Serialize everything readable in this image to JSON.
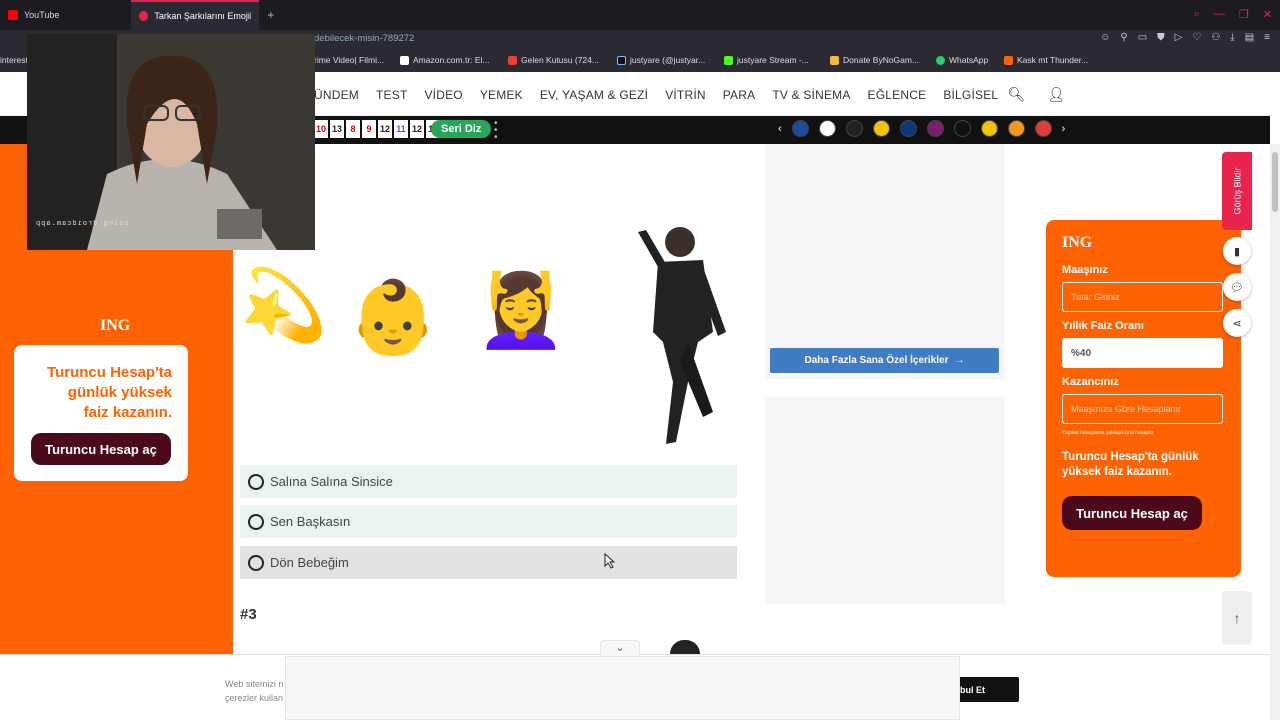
{
  "browser": {
    "tabs": [
      {
        "label": "YouTube",
        "active": false
      },
      {
        "label": "Tarkan Şarkılarını Emojilerl",
        "active": true
      }
    ],
    "new_tab_icon": "plus-icon",
    "url_fragment": "debilecek-misin-789272",
    "bookmarks": [
      {
        "label": "interest",
        "color": "#e60023"
      },
      {
        "label": "rime Video| Filmi...",
        "color": "#1a98ff"
      },
      {
        "label": "Amazon.com.tr: El...",
        "color": "#ff9900"
      },
      {
        "label": "Gelen Kutusu (724...",
        "color": "#ea4335"
      },
      {
        "label": "justyare (@justyar...",
        "color": "#111111"
      },
      {
        "label": "justyare Stream -...",
        "color": "#53fc18"
      },
      {
        "label": "Donate ByNoGam...",
        "color": "#f6b73c"
      },
      {
        "label": "WhatsApp",
        "color": "#25d366"
      },
      {
        "label": "Kask mt Thunder...",
        "color": "#ff6000"
      }
    ]
  },
  "site": {
    "menu": [
      "GÜNDEM",
      "TEST",
      "VİDEO",
      "YEMEK",
      "EV, YAŞAM & GEZİ",
      "VİTRİN",
      "PARA",
      "TV & SİNEMA",
      "EĞLENCE",
      "BİLGİSEL"
    ],
    "menu_first_visible": "ÜNDEM",
    "lotto_numbers": [
      "10",
      "13",
      "8",
      "9",
      "12",
      "11",
      "12",
      "11"
    ],
    "seri_diz_label": "Seri Diz",
    "accent": "#ff6200"
  },
  "left_ad": {
    "brand": "ING",
    "tagline": "Turuncu Hesap'ta\ngünlük yüksek\nfaiz kazanın.",
    "button": "Turuncu Hesap aç"
  },
  "quiz": {
    "emoji_clue": [
      "💫",
      "👶",
      "💆‍♀️"
    ],
    "options": [
      {
        "label": "Salına Salına Sinsice",
        "selected": false
      },
      {
        "label": "Sen Başkasın",
        "selected": false
      },
      {
        "label": "Dön Bebeğim",
        "selected": false
      }
    ],
    "next_question_label": "#3"
  },
  "right_panel": {
    "more_button": "Daha Fazla Sana Özel İçerikler"
  },
  "right_ad": {
    "brand": "ING",
    "salary_label": "Maaşınız",
    "salary_placeholder": "Tutar Giriniz",
    "rate_label": "Yıllık Faiz Oranı",
    "rate_value": "%40",
    "earnings_label": "Kazancınız",
    "earnings_placeholder": "Maaşınıza Göre Hesaplanır",
    "note": "Yapılan hesaplama yaklaşık brüt hesaptır.",
    "tagline": "Turuncu Hesap'ta günlük\nyüksek faiz kazanın.",
    "button": "Turuncu Hesap aç"
  },
  "side_tools": {
    "feedback": "Görüş Bildir"
  },
  "cookie": {
    "text": "Web sitemizi n\nçerezler kullan",
    "button": "bul Et"
  },
  "webcam": {
    "label": "using droidcam.app"
  }
}
